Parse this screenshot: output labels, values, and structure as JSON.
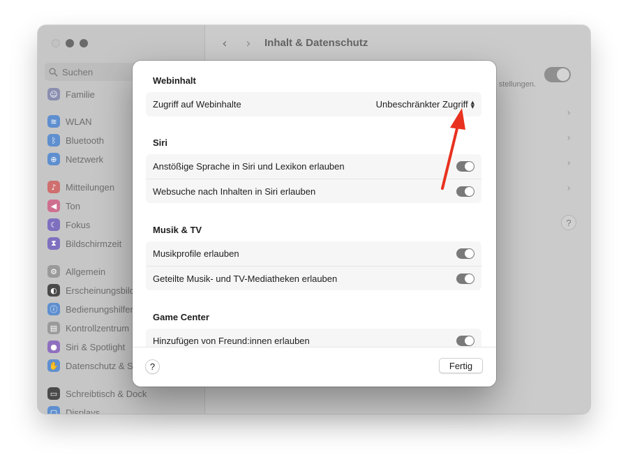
{
  "window": {
    "title": "Inhalt & Datenschutz",
    "search_placeholder": "Suchen"
  },
  "sidebar": {
    "items": [
      {
        "label": "Familie",
        "icon": "family-icon",
        "color": "#8a8fb0"
      },
      {
        "label": "WLAN",
        "icon": "wifi-icon",
        "color": "#5f8fcf"
      },
      {
        "label": "Bluetooth",
        "icon": "bluetooth-icon",
        "color": "#5f8fcf"
      },
      {
        "label": "Netzwerk",
        "icon": "globe-icon",
        "color": "#5f8fcf"
      },
      {
        "label": "Mitteilungen",
        "icon": "bell-icon",
        "color": "#cf6f6f"
      },
      {
        "label": "Ton",
        "icon": "speaker-icon",
        "color": "#cf6f8f"
      },
      {
        "label": "Fokus",
        "icon": "moon-icon",
        "color": "#7f6fbf"
      },
      {
        "label": "Bildschirmzeit",
        "icon": "hourglass-icon",
        "color": "#7f6fbf"
      },
      {
        "label": "Allgemein",
        "icon": "gear-icon",
        "color": "#9a9a9a"
      },
      {
        "label": "Erscheinungsbild",
        "icon": "appearance-icon",
        "color": "#4a4a4a"
      },
      {
        "label": "Bedienungshilfen",
        "icon": "accessibility-icon",
        "color": "#5f8fcf"
      },
      {
        "label": "Kontrollzentrum",
        "icon": "control-center-icon",
        "color": "#9a9a9a"
      },
      {
        "label": "Siri & Spotlight",
        "icon": "siri-icon",
        "color": "#8f6fbf"
      },
      {
        "label": "Datenschutz & Sicherheit",
        "icon": "hand-icon",
        "color": "#5f8fcf"
      },
      {
        "label": "Schreibtisch & Dock",
        "icon": "dock-icon",
        "color": "#4a4a4a"
      },
      {
        "label": "Displays",
        "icon": "display-icon",
        "color": "#5f8fcf"
      }
    ]
  },
  "background_content": {
    "toggle_text": "stellungen."
  },
  "sheet": {
    "sections": [
      {
        "title": "Webinhalt",
        "rows": [
          {
            "label": "Zugriff auf Webinhalte",
            "type": "popup",
            "value": "Unbeschränkter Zugriff"
          }
        ]
      },
      {
        "title": "Siri",
        "rows": [
          {
            "label": "Anstößige Sprache in Siri und Lexikon erlauben",
            "type": "toggle",
            "on": true
          },
          {
            "label": "Websuche nach Inhalten in Siri erlauben",
            "type": "toggle",
            "on": true
          }
        ]
      },
      {
        "title": "Musik & TV",
        "rows": [
          {
            "label": "Musikprofile erlauben",
            "type": "toggle",
            "on": true
          },
          {
            "label": "Geteilte Musik- und TV-Mediatheken erlauben",
            "type": "toggle",
            "on": true
          }
        ]
      },
      {
        "title": "Game Center",
        "rows": [
          {
            "label": "Hinzufügen von Freund:innen erlauben",
            "type": "toggle",
            "on": true
          }
        ]
      }
    ],
    "help_label": "?",
    "done_label": "Fertig"
  },
  "annotation": {
    "arrow_color": "#e8321f"
  }
}
